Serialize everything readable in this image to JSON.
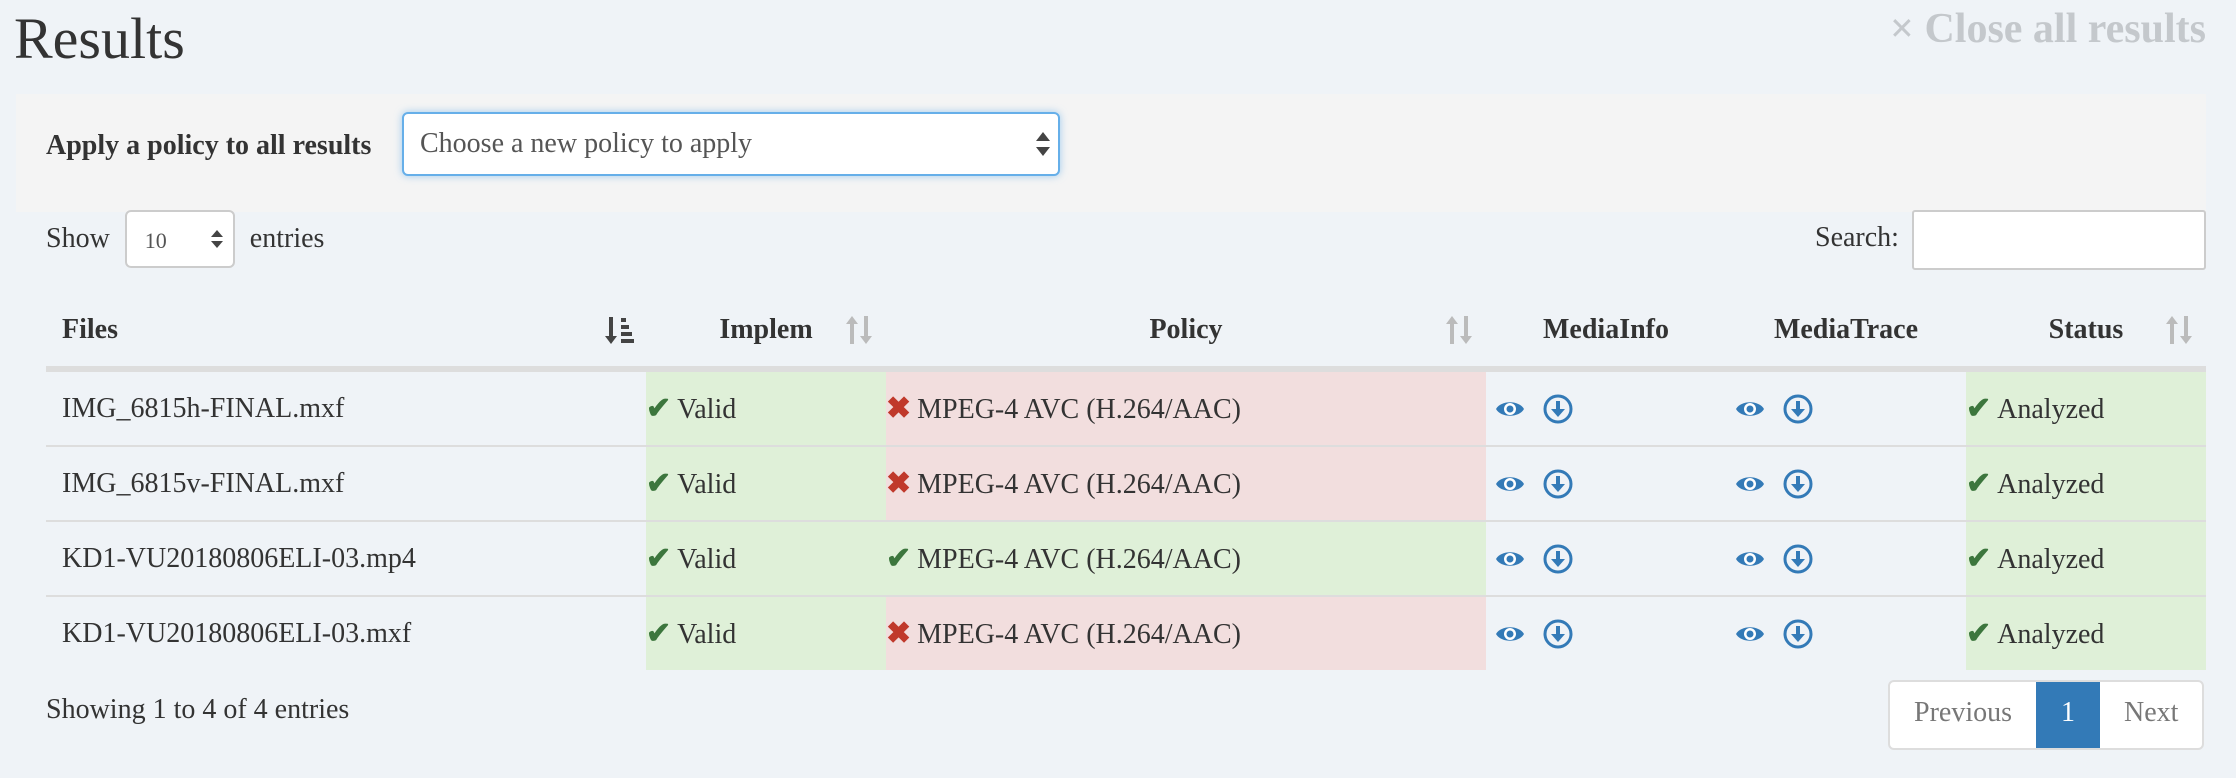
{
  "page": {
    "title": "Results",
    "close_label": "× Close all results"
  },
  "policy_bar": {
    "label": "Apply a policy to all results",
    "select_value": "Choose a new policy to apply"
  },
  "length": {
    "show_label": "Show",
    "value": "10",
    "entries_label": "entries"
  },
  "search": {
    "label": "Search:",
    "value": ""
  },
  "table": {
    "headers": [
      "Files",
      "Implem",
      "Policy",
      "MediaInfo",
      "MediaTrace",
      "Status"
    ],
    "rows": [
      {
        "file": "IMG_6815h-FINAL.mxf",
        "implem": "Valid",
        "implem_ok": true,
        "policy": "MPEG-4 AVC (H.264/AAC)",
        "policy_ok": false,
        "status": "Analyzed"
      },
      {
        "file": "IMG_6815v-FINAL.mxf",
        "implem": "Valid",
        "implem_ok": true,
        "policy": "MPEG-4 AVC (H.264/AAC)",
        "policy_ok": false,
        "status": "Analyzed"
      },
      {
        "file": "KD1-VU20180806ELI-03.mp4",
        "implem": "Valid",
        "implem_ok": true,
        "policy": "MPEG-4 AVC (H.264/AAC)",
        "policy_ok": true,
        "status": "Analyzed"
      },
      {
        "file": "KD1-VU20180806ELI-03.mxf",
        "implem": "Valid",
        "implem_ok": true,
        "policy": "MPEG-4 AVC (H.264/AAC)",
        "policy_ok": false,
        "status": "Analyzed"
      }
    ]
  },
  "footer": {
    "info": "Showing 1 to 4 of 4 entries",
    "previous": "Previous",
    "page": "1",
    "next": "Next"
  },
  "colors": {
    "valid_bg": "#dff0d8",
    "invalid_bg": "#f2dede",
    "valid_icon": "#3c763d",
    "invalid_icon": "#c0392b",
    "accent": "#337ab7"
  },
  "icons": [
    "eye-icon",
    "download-icon",
    "checkmark-icon",
    "cross-icon",
    "sort-icon"
  ]
}
